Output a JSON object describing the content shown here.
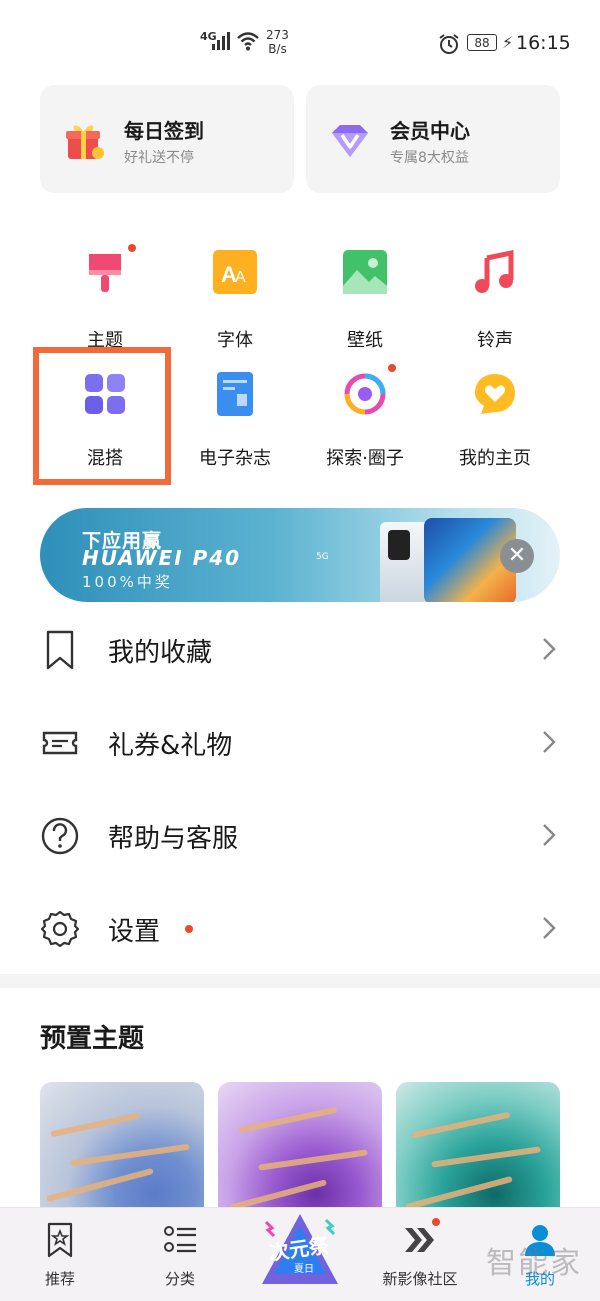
{
  "status_bar": {
    "network": "4G",
    "speed_value": "273",
    "speed_unit": "B/s",
    "battery": "88",
    "time": "16:15"
  },
  "cards": [
    {
      "title": "每日签到",
      "subtitle": "好礼送不停",
      "icon": "gift-icon"
    },
    {
      "title": "会员中心",
      "subtitle": "专属8大权益",
      "icon": "vip-diamond-icon"
    }
  ],
  "grid": [
    {
      "label": "主题",
      "icon": "theme-brush-icon",
      "badge": true
    },
    {
      "label": "字体",
      "icon": "font-icon",
      "badge": false
    },
    {
      "label": "壁纸",
      "icon": "wallpaper-icon",
      "badge": false
    },
    {
      "label": "铃声",
      "icon": "ringtone-icon",
      "badge": false
    },
    {
      "label": "混搭",
      "icon": "mix-grid-icon",
      "badge": false
    },
    {
      "label": "电子杂志",
      "icon": "magazine-icon",
      "badge": false
    },
    {
      "label": "探索·圈子",
      "icon": "explore-circle-icon",
      "badge": true
    },
    {
      "label": "我的主页",
      "icon": "my-home-heart-icon",
      "badge": false
    }
  ],
  "banner": {
    "line1": "下应用赢",
    "line2": "HUAWEI P40",
    "line2_suffix": "5G",
    "line3": "100%中奖"
  },
  "list": [
    {
      "label": "我的收藏",
      "icon": "bookmark-icon"
    },
    {
      "label": "礼券&礼物",
      "icon": "coupon-icon"
    },
    {
      "label": "帮助与客服",
      "icon": "help-icon"
    },
    {
      "label": "设置",
      "icon": "settings-gear-icon",
      "badge": true
    }
  ],
  "section_title": "预置主题",
  "tabs": [
    {
      "label": "推荐",
      "icon": "star-bookmark-icon",
      "active": false
    },
    {
      "label": "分类",
      "icon": "category-list-icon",
      "active": false
    },
    {
      "label": "新影像社区",
      "icon": "double-chevron-icon",
      "active": false
    },
    {
      "label": "我的",
      "icon": "user-icon",
      "active": true
    }
  ],
  "center_logo_text": "次元祭",
  "center_logo_sub": "夏日",
  "watermark": "智能家",
  "colors": {
    "accent": "#0a8fd6",
    "highlight": "#f26a3a",
    "badge": "#e84a2c"
  }
}
